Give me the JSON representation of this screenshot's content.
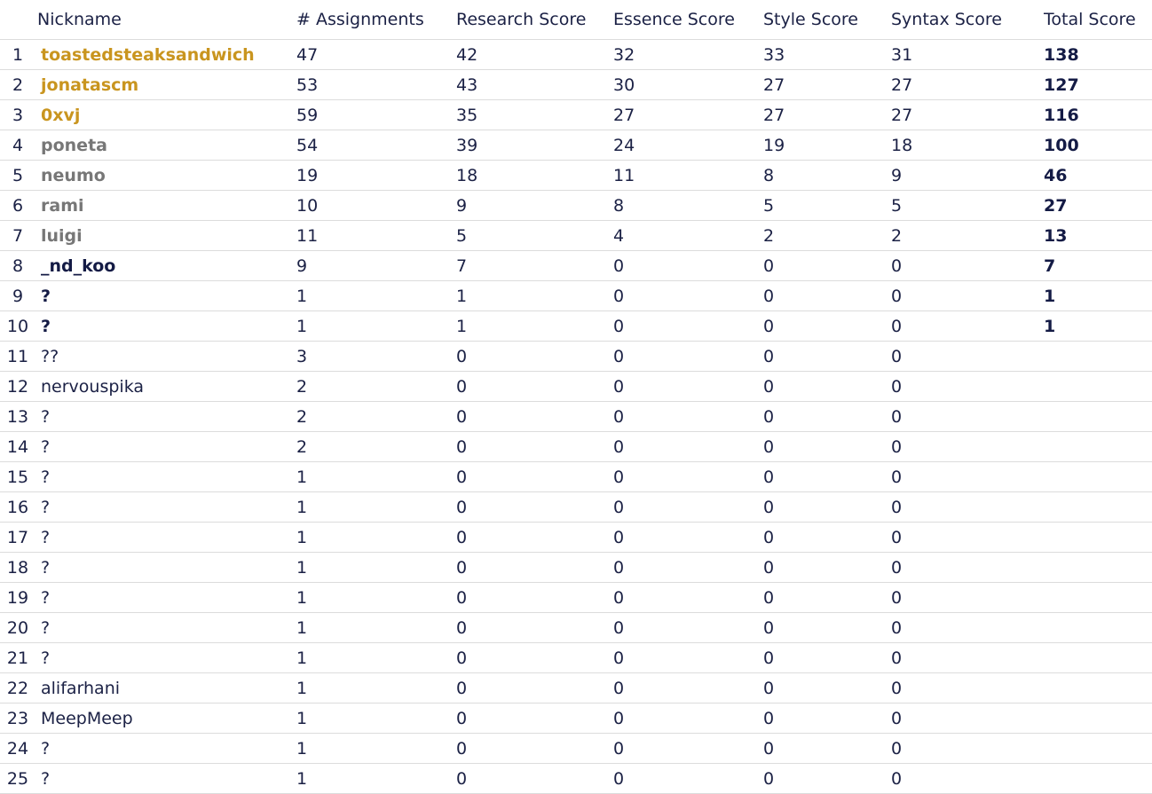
{
  "headers": [
    "",
    "Nickname",
    "# Assignments",
    "Research Score",
    "Essence Score",
    "Style Score",
    "Syntax Score",
    "Total Score"
  ],
  "colors": {
    "gold": "#c9951f",
    "gray": "#777777",
    "navy": "#141b45"
  },
  "rows": [
    {
      "rank": "1",
      "nick": "toastedsteaksandwich",
      "style": "gold",
      "assignments": "47",
      "research": "42",
      "essence": "32",
      "style_score": "33",
      "syntax": "31",
      "total": "138"
    },
    {
      "rank": "2",
      "nick": "jonatascm",
      "style": "gold",
      "assignments": "53",
      "research": "43",
      "essence": "30",
      "style_score": "27",
      "syntax": "27",
      "total": "127"
    },
    {
      "rank": "3",
      "nick": "0xvj",
      "style": "gold",
      "assignments": "59",
      "research": "35",
      "essence": "27",
      "style_score": "27",
      "syntax": "27",
      "total": "116"
    },
    {
      "rank": "4",
      "nick": "poneta",
      "style": "gray",
      "assignments": "54",
      "research": "39",
      "essence": "24",
      "style_score": "19",
      "syntax": "18",
      "total": "100"
    },
    {
      "rank": "5",
      "nick": "neumo",
      "style": "gray",
      "assignments": "19",
      "research": "18",
      "essence": "11",
      "style_score": "8",
      "syntax": "9",
      "total": "46"
    },
    {
      "rank": "6",
      "nick": "rami",
      "style": "gray",
      "assignments": "10",
      "research": "9",
      "essence": "8",
      "style_score": "5",
      "syntax": "5",
      "total": "27"
    },
    {
      "rank": "7",
      "nick": "luigi",
      "style": "gray",
      "assignments": "11",
      "research": "5",
      "essence": "4",
      "style_score": "2",
      "syntax": "2",
      "total": "13"
    },
    {
      "rank": "8",
      "nick": "_nd_koo",
      "style": "bold",
      "assignments": "9",
      "research": "7",
      "essence": "0",
      "style_score": "0",
      "syntax": "0",
      "total": "7"
    },
    {
      "rank": "9",
      "nick": "?",
      "style": "bold",
      "assignments": "1",
      "research": "1",
      "essence": "0",
      "style_score": "0",
      "syntax": "0",
      "total": "1"
    },
    {
      "rank": "10",
      "nick": "?",
      "style": "bold",
      "assignments": "1",
      "research": "1",
      "essence": "0",
      "style_score": "0",
      "syntax": "0",
      "total": "1"
    },
    {
      "rank": "11",
      "nick": "??",
      "style": "plain",
      "assignments": "3",
      "research": "0",
      "essence": "0",
      "style_score": "0",
      "syntax": "0",
      "total": ""
    },
    {
      "rank": "12",
      "nick": "nervouspika",
      "style": "plain",
      "assignments": "2",
      "research": "0",
      "essence": "0",
      "style_score": "0",
      "syntax": "0",
      "total": ""
    },
    {
      "rank": "13",
      "nick": "?",
      "style": "plain",
      "assignments": "2",
      "research": "0",
      "essence": "0",
      "style_score": "0",
      "syntax": "0",
      "total": ""
    },
    {
      "rank": "14",
      "nick": "?",
      "style": "plain",
      "assignments": "2",
      "research": "0",
      "essence": "0",
      "style_score": "0",
      "syntax": "0",
      "total": ""
    },
    {
      "rank": "15",
      "nick": "?",
      "style": "plain",
      "assignments": "1",
      "research": "0",
      "essence": "0",
      "style_score": "0",
      "syntax": "0",
      "total": ""
    },
    {
      "rank": "16",
      "nick": "?",
      "style": "plain",
      "assignments": "1",
      "research": "0",
      "essence": "0",
      "style_score": "0",
      "syntax": "0",
      "total": ""
    },
    {
      "rank": "17",
      "nick": "?",
      "style": "plain",
      "assignments": "1",
      "research": "0",
      "essence": "0",
      "style_score": "0",
      "syntax": "0",
      "total": ""
    },
    {
      "rank": "18",
      "nick": "?",
      "style": "plain",
      "assignments": "1",
      "research": "0",
      "essence": "0",
      "style_score": "0",
      "syntax": "0",
      "total": ""
    },
    {
      "rank": "19",
      "nick": "?",
      "style": "plain",
      "assignments": "1",
      "research": "0",
      "essence": "0",
      "style_score": "0",
      "syntax": "0",
      "total": ""
    },
    {
      "rank": "20",
      "nick": "?",
      "style": "plain",
      "assignments": "1",
      "research": "0",
      "essence": "0",
      "style_score": "0",
      "syntax": "0",
      "total": ""
    },
    {
      "rank": "21",
      "nick": "?",
      "style": "plain",
      "assignments": "1",
      "research": "0",
      "essence": "0",
      "style_score": "0",
      "syntax": "0",
      "total": ""
    },
    {
      "rank": "22",
      "nick": "alifarhani",
      "style": "plain",
      "assignments": "1",
      "research": "0",
      "essence": "0",
      "style_score": "0",
      "syntax": "0",
      "total": ""
    },
    {
      "rank": "23",
      "nick": "MeepMeep",
      "style": "plain",
      "assignments": "1",
      "research": "0",
      "essence": "0",
      "style_score": "0",
      "syntax": "0",
      "total": ""
    },
    {
      "rank": "24",
      "nick": "?",
      "style": "plain",
      "assignments": "1",
      "research": "0",
      "essence": "0",
      "style_score": "0",
      "syntax": "0",
      "total": ""
    },
    {
      "rank": "25",
      "nick": "?",
      "style": "plain",
      "assignments": "1",
      "research": "0",
      "essence": "0",
      "style_score": "0",
      "syntax": "0",
      "total": ""
    }
  ]
}
